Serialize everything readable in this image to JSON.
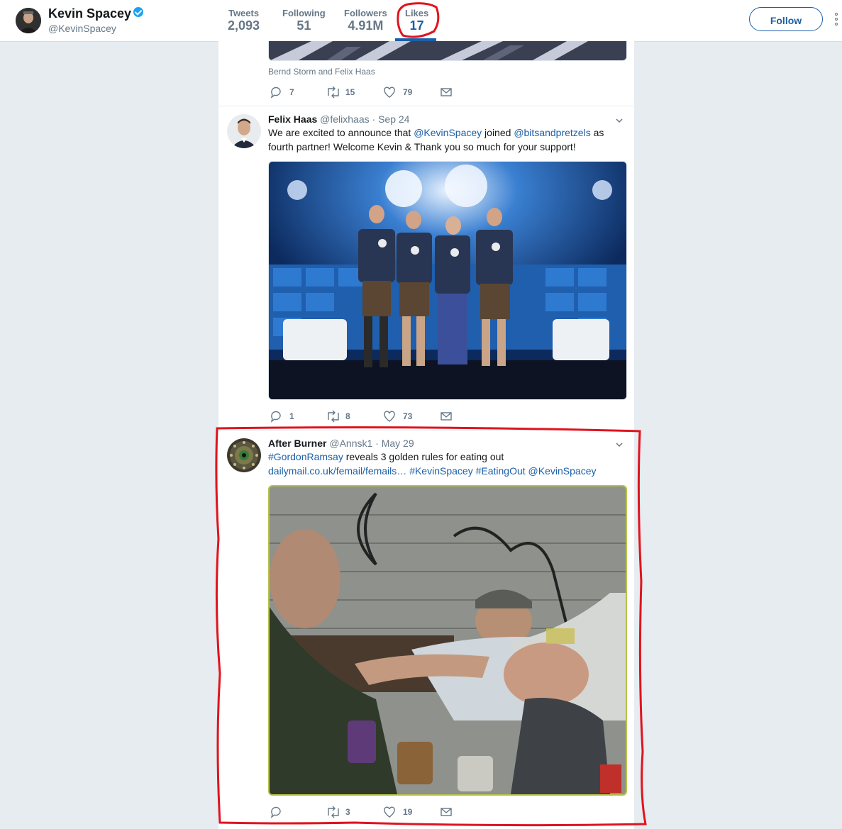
{
  "profile": {
    "name": "Kevin Spacey",
    "handle": "@KevinSpacey",
    "follow_label": "Follow",
    "stats": [
      {
        "label": "Tweets",
        "value": "2,093"
      },
      {
        "label": "Following",
        "value": "51"
      },
      {
        "label": "Followers",
        "value": "4.91M"
      },
      {
        "label": "Likes",
        "value": "17"
      }
    ]
  },
  "tweets": [
    {
      "caption": "Bernd Storm and Felix Haas",
      "replies": "7",
      "retweets": "15",
      "likes": "79"
    },
    {
      "name": "Felix Haas",
      "handle": "@felixhaas",
      "date": "· Sep 24",
      "text_parts": [
        "We are excited to announce that ",
        "@KevinSpacey",
        " joined ",
        "@bitsandpretzels",
        " as",
        "fourth partner! Welcome Kevin & Thank you so much for your support!"
      ],
      "replies": "1",
      "retweets": "8",
      "likes": "73"
    },
    {
      "name": "After Burner",
      "handle": "@Annsk1",
      "date": "· May 29",
      "text_parts": [
        "#GordonRamsay",
        " reveals 3 golden rules for eating out",
        "dailymail.co.uk/femail/femails…",
        " ",
        "#KevinSpacey",
        " ",
        "#EatingOut",
        " ",
        "@KevinSpacey"
      ],
      "replies": "",
      "retweets": "3",
      "likes": "19"
    }
  ],
  "colors": {
    "link": "#1b5fa8",
    "annotation": "#e0141e",
    "background": "#e6ecf0"
  }
}
